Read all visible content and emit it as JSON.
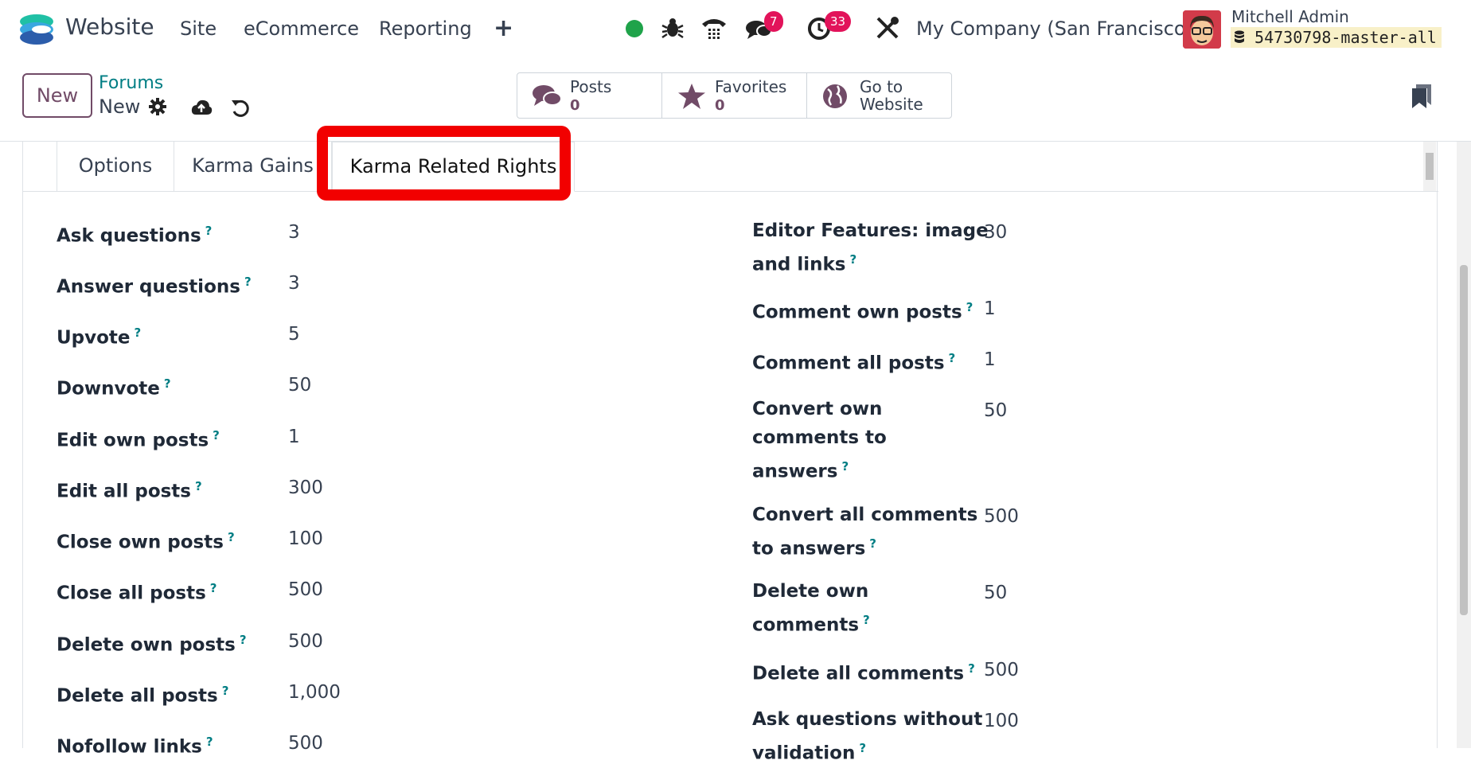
{
  "navbar": {
    "app_name": "Website",
    "menu": [
      "Site",
      "eCommerce",
      "Reporting"
    ],
    "plus": "+",
    "badges": {
      "messages": "7",
      "activities": "33"
    },
    "company": "My Company (San Francisco)",
    "user_name": "Mitchell Admin",
    "db_name": "54730798-master-all",
    "icons": [
      "status-online-icon",
      "bug-icon",
      "phone-icon",
      "chat-icon",
      "clock-icon",
      "tools-icon"
    ]
  },
  "control": {
    "new_label": "New",
    "breadcrumb_parent": "Forums",
    "breadcrumb_current": "New",
    "smart_buttons": [
      {
        "label": "Posts",
        "value": "0",
        "icon": "comments-icon"
      },
      {
        "label": "Favorites",
        "value": "0",
        "icon": "star-icon"
      },
      {
        "label": "Go to",
        "label2": "Website",
        "icon": "globe-icon"
      }
    ]
  },
  "tabs": [
    "Options",
    "Karma Gains",
    "Karma Related Rights"
  ],
  "active_tab": "Karma Related Rights",
  "left_fields": [
    {
      "label": "Ask questions",
      "value": "3"
    },
    {
      "label": "Answer questions",
      "value": "3"
    },
    {
      "label": "Upvote",
      "value": "5"
    },
    {
      "label": "Downvote",
      "value": "50"
    },
    {
      "label": "Edit own posts",
      "value": "1"
    },
    {
      "label": "Edit all posts",
      "value": "300"
    },
    {
      "label": "Close own posts",
      "value": "100"
    },
    {
      "label": "Close all posts",
      "value": "500"
    },
    {
      "label": "Delete own posts",
      "value": "500"
    },
    {
      "label": "Delete all posts",
      "value": "1,000"
    },
    {
      "label": "Nofollow links",
      "value": "500"
    }
  ],
  "right_fields": [
    {
      "label_lines": [
        "Editor Features: image",
        "and links"
      ],
      "value": "30"
    },
    {
      "label_lines": [
        "Comment own posts"
      ],
      "value": "1"
    },
    {
      "label_lines": [
        "Comment all posts"
      ],
      "value": "1"
    },
    {
      "label_lines": [
        "Convert own",
        "comments to",
        "answers"
      ],
      "value": "50"
    },
    {
      "label_lines": [
        "Convert all comments",
        "to answers"
      ],
      "value": "500"
    },
    {
      "label_lines": [
        "Delete own",
        "comments"
      ],
      "value": "50"
    },
    {
      "label_lines": [
        "Delete all comments"
      ],
      "value": "500"
    },
    {
      "label_lines": [
        "Ask questions without",
        "validation"
      ],
      "value": "100"
    }
  ],
  "help_marker": "?",
  "colors": {
    "brand": "#714b67",
    "link": "#017e84",
    "badge": "#e2135a",
    "highlight": "#f20000"
  }
}
